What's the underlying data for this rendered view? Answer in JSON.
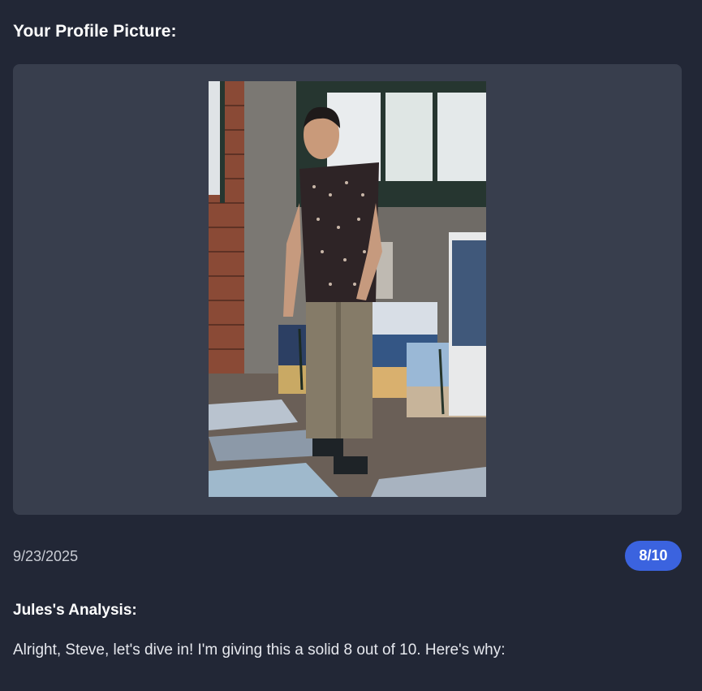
{
  "header": {
    "title": "Your Profile Picture:"
  },
  "profile_photo": {
    "icon": "photo-of-man-in-art-studio",
    "colors": {
      "card_background": "#383e4d",
      "page_background": "#222736"
    }
  },
  "rating": {
    "date": "9/23/2025",
    "score": "8/10",
    "badge_color": "#3b63df"
  },
  "analysis": {
    "heading": "Jules's Analysis:",
    "body": "Alright, Steve, let's dive in! I'm giving this a solid 8 out of 10. Here's why:"
  }
}
